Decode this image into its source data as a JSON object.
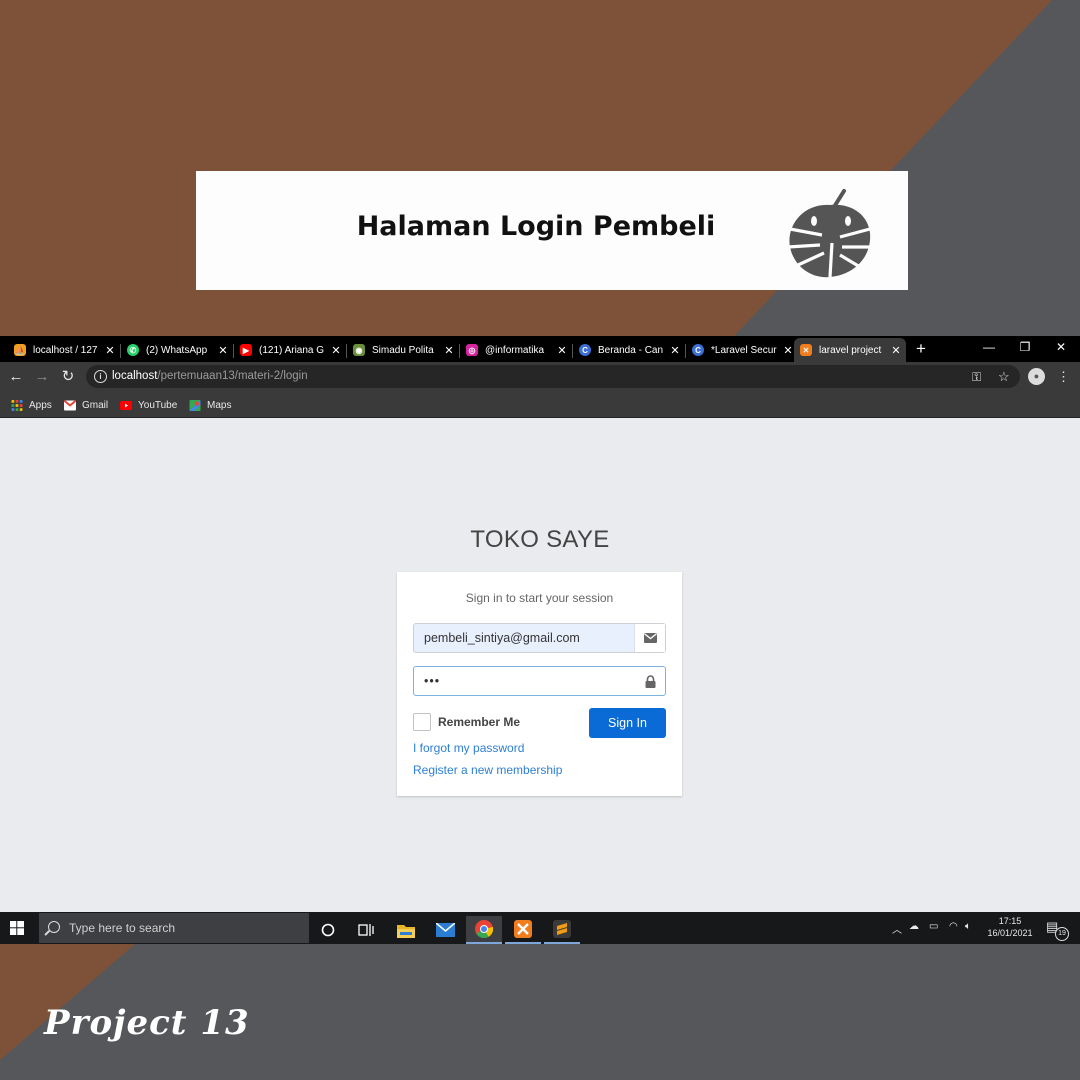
{
  "banner": {
    "title": "Halaman Login Pembeli"
  },
  "browser": {
    "tabs": [
      {
        "label": "localhost / 127",
        "icon": "phpmyadmin-icon",
        "color": "#f0a020"
      },
      {
        "label": "(2) WhatsApp",
        "icon": "whatsapp-icon",
        "color": "#25d366"
      },
      {
        "label": "(121) Ariana G",
        "icon": "youtube-icon",
        "color": "#ff0000"
      },
      {
        "label": "Simadu Polita",
        "icon": "simadu-icon",
        "color": "#6a8f3a"
      },
      {
        "label": "@informatika",
        "icon": "instagram-icon",
        "color": "#d6249f"
      },
      {
        "label": "Beranda - Can",
        "icon": "canva-icon",
        "color": "#3b6fd6"
      },
      {
        "label": "*Laravel Secur",
        "icon": "canva-icon",
        "color": "#3b6fd6"
      },
      {
        "label": "laravel project",
        "icon": "xampp-icon",
        "color": "#f07d1e"
      }
    ],
    "url_host": "localhost",
    "url_path": "/pertemuaan13/materi-2/login",
    "bookmarks": [
      {
        "label": "Apps",
        "icon": "apps-grid-icon"
      },
      {
        "label": "Gmail",
        "icon": "gmail-icon"
      },
      {
        "label": "YouTube",
        "icon": "youtube-icon"
      },
      {
        "label": "Maps",
        "icon": "maps-icon"
      }
    ]
  },
  "login": {
    "logo": "TOKO SAYE",
    "message": "Sign in to start your session",
    "email_value": "pembeli_sintiya@gmail.com",
    "password_value": "•••",
    "remember_label": "Remember Me",
    "signin_label": "Sign In",
    "forgot_label": "I forgot my password",
    "register_label": "Register a new membership"
  },
  "taskbar": {
    "search_placeholder": "Type here to search",
    "time": "17:15",
    "date": "16/01/2021",
    "notification_count": "19"
  },
  "footer": {
    "project_label": "Project 13"
  },
  "colors": {
    "brown": "#7e5238",
    "gray": "#56575b",
    "signin_blue": "#0a6bd6",
    "link_blue": "#2d7fd3"
  }
}
